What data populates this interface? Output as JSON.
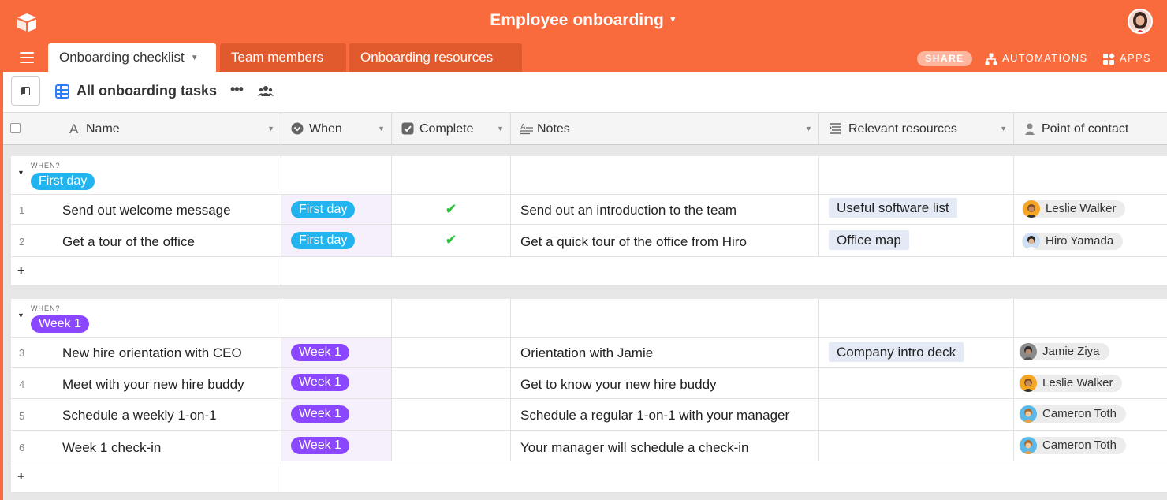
{
  "base": {
    "title": "Employee onboarding"
  },
  "tabs": [
    {
      "label": "Onboarding checklist"
    },
    {
      "label": "Team members"
    },
    {
      "label": "Onboarding resources"
    }
  ],
  "toolbar": {
    "share_label": "SHARE",
    "automations_label": "AUTOMATIONS",
    "apps_label": "APPS"
  },
  "view": {
    "name": "All onboarding tasks",
    "more": "•••"
  },
  "columns": [
    {
      "label": "Name",
      "icon": "text-field-icon"
    },
    {
      "label": "When",
      "icon": "single-select-icon"
    },
    {
      "label": "Complete",
      "icon": "checkbox-icon"
    },
    {
      "label": "Notes",
      "icon": "long-text-icon"
    },
    {
      "label": "Relevant resources",
      "icon": "linked-record-icon"
    },
    {
      "label": "Point of contact",
      "icon": "user-icon"
    }
  ],
  "group_field_label": "WHEN?",
  "groups": [
    {
      "label": "First day",
      "color": "#21b4ee",
      "rows": [
        {
          "num": "1",
          "name": "Send out welcome message",
          "when": "First day",
          "complete": true,
          "notes": "Send out an introduction to the team",
          "resource": "Useful software list",
          "contact": "Leslie Walker"
        },
        {
          "num": "2",
          "name": "Get a tour of the office",
          "when": "First day",
          "complete": true,
          "notes": "Get a quick tour of the office from Hiro",
          "resource": "Office map",
          "contact": "Hiro Yamada"
        }
      ]
    },
    {
      "label": "Week 1",
      "color": "#8b46ff",
      "rows": [
        {
          "num": "3",
          "name": "New hire orientation with CEO",
          "when": "Week 1",
          "complete": false,
          "notes": "Orientation with Jamie",
          "resource": "Company intro deck",
          "contact": "Jamie Ziya"
        },
        {
          "num": "4",
          "name": "Meet with your new hire buddy",
          "when": "Week 1",
          "complete": false,
          "notes": "Get to know your new hire buddy",
          "resource": "",
          "contact": "Leslie Walker"
        },
        {
          "num": "5",
          "name": "Schedule a weekly 1-on-1",
          "when": "Week 1",
          "complete": false,
          "notes": "Schedule a regular 1-on-1 with your manager",
          "resource": "",
          "contact": "Cameron Toth"
        },
        {
          "num": "6",
          "name": "Week 1 check-in",
          "when": "Week 1",
          "complete": false,
          "notes": "Your manager will schedule a check-in",
          "resource": "",
          "contact": "Cameron Toth"
        }
      ]
    }
  ],
  "add_row_symbol": "+",
  "colors": {
    "brand": "#f96b3d",
    "tab_inactive": "#e05a2e",
    "first_day": "#21b4ee",
    "week_1": "#8b46ff",
    "check": "#20c933",
    "resource_chip": "#e3eaf6"
  }
}
